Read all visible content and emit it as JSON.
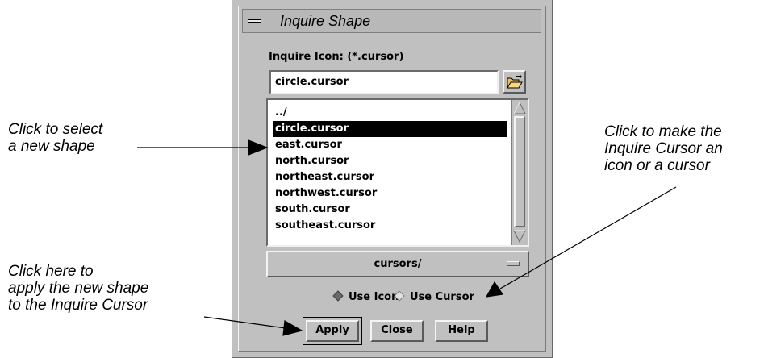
{
  "dialog": {
    "title": "Inquire Shape",
    "inquire_icon_label": "Inquire Icon: (*.cursor)",
    "filename_value": "circle.cursor",
    "file_list": [
      "../",
      "circle.cursor",
      "east.cursor",
      "north.cursor",
      "northeast.cursor",
      "northwest.cursor",
      "south.cursor",
      "southeast.cursor"
    ],
    "selected_file": "circle.cursor",
    "directory_label": "cursors/",
    "radio_use_icon": "Use Icon",
    "radio_use_cursor": "Use Cursor",
    "selected_mode": "Use Icon",
    "buttons": {
      "apply": "Apply",
      "close": "Close",
      "help": "Help"
    }
  },
  "annotations": {
    "select_shape": [
      "Click to select",
      "a new shape"
    ],
    "icon_or_cursor": [
      "Click to make the",
      "Inquire Cursor an",
      "icon or a cursor"
    ],
    "apply_shape": [
      "Click here to",
      "apply the new shape",
      "to the Inquire Cursor"
    ]
  },
  "icons": {
    "window_menu": "window-menu-icon",
    "folder": "open-folder-icon",
    "scroll_up": "scroll-up-arrow-icon",
    "scroll_down": "scroll-down-arrow-icon",
    "option_menu": "option-menu-indicator-icon"
  }
}
